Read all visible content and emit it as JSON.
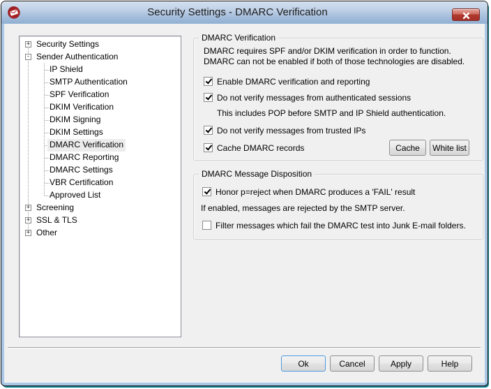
{
  "window": {
    "title": "Security Settings - DMARC Verification"
  },
  "tree": {
    "items": [
      {
        "label": "Security Settings",
        "expander": "+",
        "selected": false
      },
      {
        "label": "Sender Authentication",
        "expander": "-",
        "selected": false
      },
      {
        "label": "IP Shield",
        "selected": false
      },
      {
        "label": "SMTP Authentication",
        "selected": false
      },
      {
        "label": "SPF Verification",
        "selected": false
      },
      {
        "label": "DKIM Verification",
        "selected": false
      },
      {
        "label": "DKIM Signing",
        "selected": false
      },
      {
        "label": "DKIM Settings",
        "selected": false
      },
      {
        "label": "DMARC Verification",
        "selected": true
      },
      {
        "label": "DMARC Reporting",
        "selected": false
      },
      {
        "label": "DMARC Settings",
        "selected": false
      },
      {
        "label": "VBR Certification",
        "selected": false
      },
      {
        "label": "Approved List",
        "selected": false
      },
      {
        "label": "Screening",
        "expander": "+",
        "selected": false
      },
      {
        "label": "SSL & TLS",
        "expander": "+",
        "selected": false
      },
      {
        "label": "Other",
        "expander": "+",
        "selected": false
      }
    ]
  },
  "groups": {
    "verification": {
      "title": "DMARC Verification",
      "description": "DMARC requires SPF and/or DKIM verification in order to function.  DMARC can not be enabled if both of those technologies are disabled.",
      "checkboxes": [
        {
          "label": "Enable DMARC verification and reporting",
          "checked": true
        },
        {
          "label": "Do not verify messages from authenticated sessions",
          "checked": true
        },
        {
          "label": "Do not verify messages from trusted IPs",
          "checked": true
        },
        {
          "label": "Cache DMARC records",
          "checked": true
        }
      ],
      "note": "This includes POP before SMTP and IP Shield authentication.",
      "buttons": {
        "cache": "Cache",
        "white_list": "White list"
      }
    },
    "disposition": {
      "title": "DMARC Message Disposition",
      "checkboxes": [
        {
          "label": "Honor p=reject when DMARC produces a 'FAIL' result",
          "checked": true
        },
        {
          "label": "Filter messages which fail the DMARC test into Junk E-mail folders.",
          "checked": false
        }
      ],
      "note": "If enabled, messages are rejected by the SMTP server."
    }
  },
  "footer": {
    "buttons": [
      {
        "label": "Ok",
        "default": true
      },
      {
        "label": "Cancel",
        "default": false
      },
      {
        "label": "Apply",
        "default": false
      },
      {
        "label": "Help",
        "default": false
      }
    ]
  },
  "colors": {
    "titlebar_top": "#d3e0ef",
    "titlebar_bottom": "#8fafd3",
    "frame_blue": "#aac7e6",
    "dialog_bg": "#f0f0f0",
    "brand_red": "#a61e22",
    "selection_gray": "#ececec",
    "default_button_border": "#4e9ae0"
  }
}
